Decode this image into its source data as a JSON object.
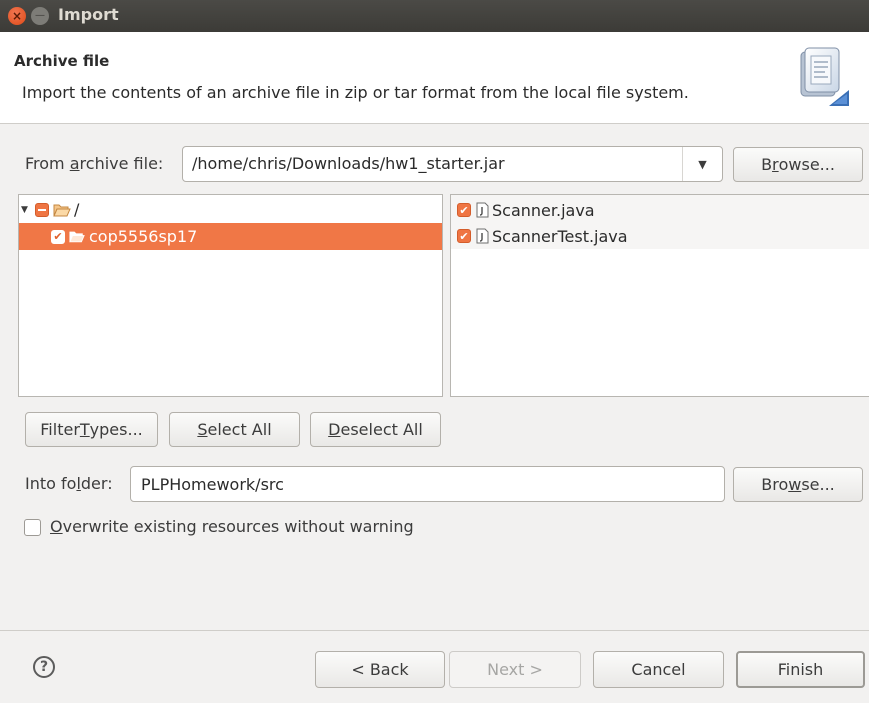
{
  "window": {
    "title": "Import"
  },
  "header": {
    "title": "Archive file",
    "description": "Import the contents of an archive file in zip or tar format from the local file system."
  },
  "from_archive": {
    "label_pre": "From ",
    "label_mnemonic": "a",
    "label_post": "rchive file:",
    "value": "/home/chris/Downloads/hw1_starter.jar",
    "browse_pre": "B",
    "browse_mnemonic": "r",
    "browse_post": "owse..."
  },
  "tree": {
    "items": [
      {
        "label": "/",
        "checked": "partial",
        "expanded": true
      },
      {
        "label": "cop5556sp17",
        "checked": "checked",
        "selected": true
      }
    ]
  },
  "files": {
    "items": [
      {
        "label": "Scanner.java",
        "checked": "checked"
      },
      {
        "label": "ScannerTest.java",
        "checked": "checked"
      }
    ]
  },
  "buttons": {
    "filter_pre": "Filter ",
    "filter_mnemonic": "T",
    "filter_post": "ypes...",
    "select_all_mnemonic": "S",
    "select_all_post": "elect All",
    "deselect_all_mnemonic": "D",
    "deselect_all_post": "eselect All"
  },
  "into_folder": {
    "label_pre": "Into fo",
    "label_mnemonic": "l",
    "label_post": "der:",
    "value": "PLPHomework/src",
    "browse_pre": "Bro",
    "browse_mnemonic": "w",
    "browse_post": "se..."
  },
  "overwrite": {
    "mnemonic": "O",
    "label_post": "verwrite existing resources without warning",
    "checked": false
  },
  "footer": {
    "help": "?",
    "back": "< Back",
    "next": "Next >",
    "cancel": "Cancel",
    "finish": "Finish"
  }
}
